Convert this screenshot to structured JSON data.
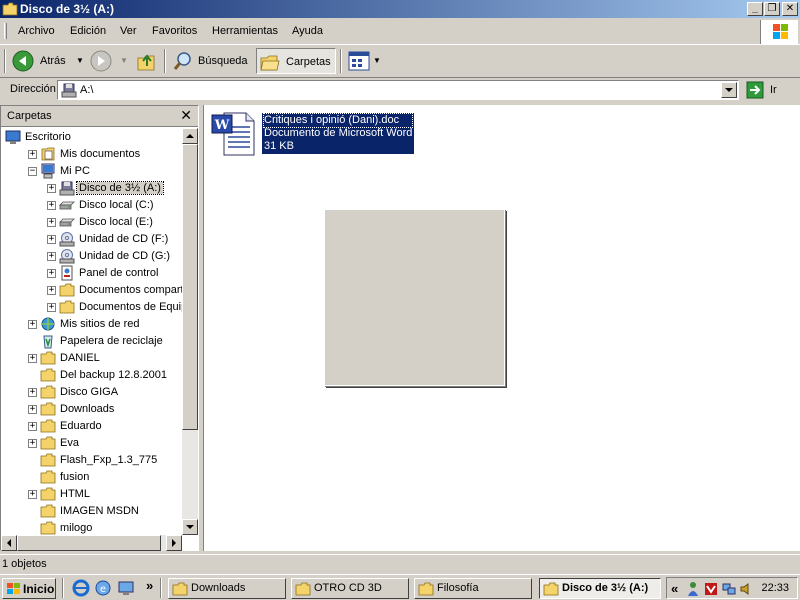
{
  "window": {
    "title": "Disco de 3½ (A:)",
    "controls": {
      "minimize": "_",
      "restore": "❐",
      "close": "✕"
    }
  },
  "menu": {
    "items": [
      {
        "label": "Archivo"
      },
      {
        "label": "Edición"
      },
      {
        "label": "Ver"
      },
      {
        "label": "Favoritos"
      },
      {
        "label": "Herramientas"
      },
      {
        "label": "Ayuda"
      }
    ]
  },
  "toolbar": {
    "back_label": "Atrás",
    "search_label": "Búsqueda",
    "folders_label": "Carpetas"
  },
  "address": {
    "label": "Dirección",
    "value": "A:\\",
    "go_label": "Ir"
  },
  "folder_pane": {
    "title": "Carpetas",
    "close_glyph": "✕",
    "items": [
      {
        "label": "Escritorio",
        "icon": "desktop-icon",
        "expander": ""
      },
      {
        "label": "Mis documentos",
        "icon": "documents-icon",
        "expander": "+"
      },
      {
        "label": "Mi PC",
        "icon": "computer-icon",
        "expander": "−"
      },
      {
        "label": "Disco de 3½ (A:)",
        "icon": "floppy-icon",
        "expander": "+"
      },
      {
        "label": "Disco local (C:)",
        "icon": "harddisk-icon",
        "expander": "+"
      },
      {
        "label": "Disco local (E:)",
        "icon": "harddisk-icon",
        "expander": "+"
      },
      {
        "label": "Unidad de CD (F:)",
        "icon": "cd-icon",
        "expander": "+"
      },
      {
        "label": "Unidad de CD (G:)",
        "icon": "cd-icon",
        "expander": "+"
      },
      {
        "label": "Panel de control",
        "icon": "control-panel-icon",
        "expander": "+"
      },
      {
        "label": "Documentos compartidos",
        "icon": "folder-icon",
        "expander": "+"
      },
      {
        "label": "Documentos de Equipo",
        "icon": "folder-icon",
        "expander": "+"
      },
      {
        "label": "Mis sitios de red",
        "icon": "network-icon",
        "expander": "+"
      },
      {
        "label": "Papelera de reciclaje",
        "icon": "recycle-bin-icon",
        "expander": ""
      },
      {
        "label": "DANIEL",
        "icon": "folder-icon",
        "expander": "+"
      },
      {
        "label": "Del backup 12.8.2001",
        "icon": "folder-icon",
        "expander": ""
      },
      {
        "label": "Disco GIGA",
        "icon": "folder-icon",
        "expander": "+"
      },
      {
        "label": "Downloads",
        "icon": "folder-icon",
        "expander": "+"
      },
      {
        "label": "Eduardo",
        "icon": "folder-icon",
        "expander": "+"
      },
      {
        "label": "Eva",
        "icon": "folder-icon",
        "expander": "+"
      },
      {
        "label": "Flash_Fxp_1.3_775",
        "icon": "folder-icon",
        "expander": ""
      },
      {
        "label": "fusion",
        "icon": "folder-icon",
        "expander": ""
      },
      {
        "label": "HTML",
        "icon": "folder-icon",
        "expander": "+"
      },
      {
        "label": "IMAGEN MSDN",
        "icon": "folder-icon",
        "expander": ""
      },
      {
        "label": "milogo",
        "icon": "folder-icon",
        "expander": ""
      }
    ]
  },
  "file": {
    "name": "Critiques i opinió (Dani).doc",
    "type": "Documento de Microsoft Word",
    "size": "31 KB"
  },
  "status": {
    "text": "1 objetos"
  },
  "taskbar": {
    "start_label": "Inicio",
    "more_glyph": "»",
    "tasks": [
      {
        "label": "Downloads",
        "active": false
      },
      {
        "label": "OTRO CD 3D",
        "active": false
      },
      {
        "label": "Filosofía",
        "active": false
      },
      {
        "label": "Disco de 3½ (A:)",
        "active": true
      }
    ],
    "tray_expand": "«",
    "clock": "22:33"
  },
  "colors": {
    "title_gradient_start": "#0a246a",
    "title_gradient_end": "#a6caf0",
    "selection": "#0a246a",
    "face": "#d4d0c8"
  }
}
